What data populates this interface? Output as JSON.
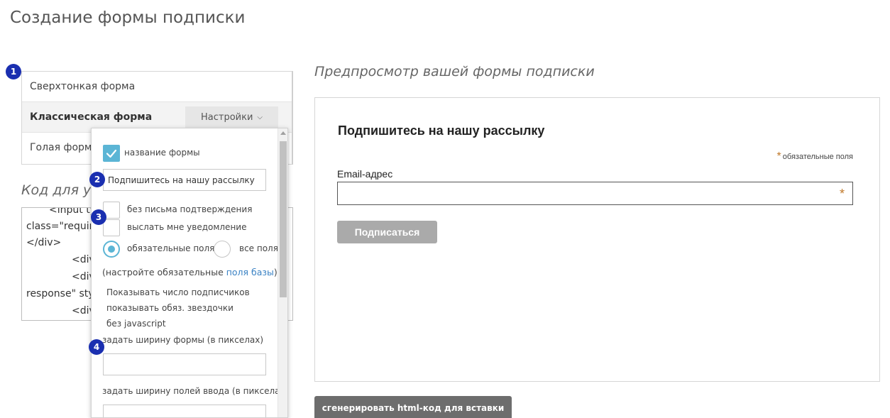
{
  "page": {
    "title": "Создание формы подписки"
  },
  "badges": [
    "1",
    "2",
    "3",
    "4"
  ],
  "form_types": {
    "items": [
      {
        "label": "Сверхтонкая форма"
      },
      {
        "label": "Классическая форма"
      },
      {
        "label": "Голая форм"
      }
    ],
    "settings_label": "Настройки"
  },
  "code": {
    "heading": "Код для ус",
    "lines": [
      "<input ty",
      "class=\"requir",
      "</div>",
      "<div",
      "<div",
      "response\" sty",
      "<div"
    ]
  },
  "settings_panel": {
    "form_name_label": "название формы",
    "form_name_value": "Подпишитесь на нашу рассылку",
    "no_confirm_label": "без письма подтверждения",
    "notify_me_label": "выслать мне уведомление",
    "required_fields_label": "обязательные поля",
    "all_fields_label": "все поля",
    "configure_prefix": "(настройте обязательные ",
    "configure_link": "поля базы",
    "configure_suffix": ")",
    "show_subscribers_label": "Показывать число подписчиков",
    "show_stars_label": "показывать обяз. звездочки",
    "no_js_label": "без javascript",
    "form_width_label": "задать ширину формы (в пикселах)",
    "form_width_value": "",
    "input_width_label": "задать ширину полей ввода (в пикселах)",
    "input_width_value": ""
  },
  "preview": {
    "heading": "Предпросмотр вашей формы подписки",
    "form_title": "Подпишитесь на нашу рассылку",
    "required_star": "*",
    "required_note": "обязательные поля",
    "email_label": "Email-адрес",
    "submit_label": "Подписаться"
  },
  "generate_button": "сгенерировать html-код для вставки",
  "colors": {
    "badge": "#1a2fb0",
    "checkbox_accent": "#5bb5d5",
    "link": "#3a82c4",
    "star": "#c0792a",
    "submit_disabled": "#aaaaaa",
    "generate_button": "#6d6d6d"
  }
}
